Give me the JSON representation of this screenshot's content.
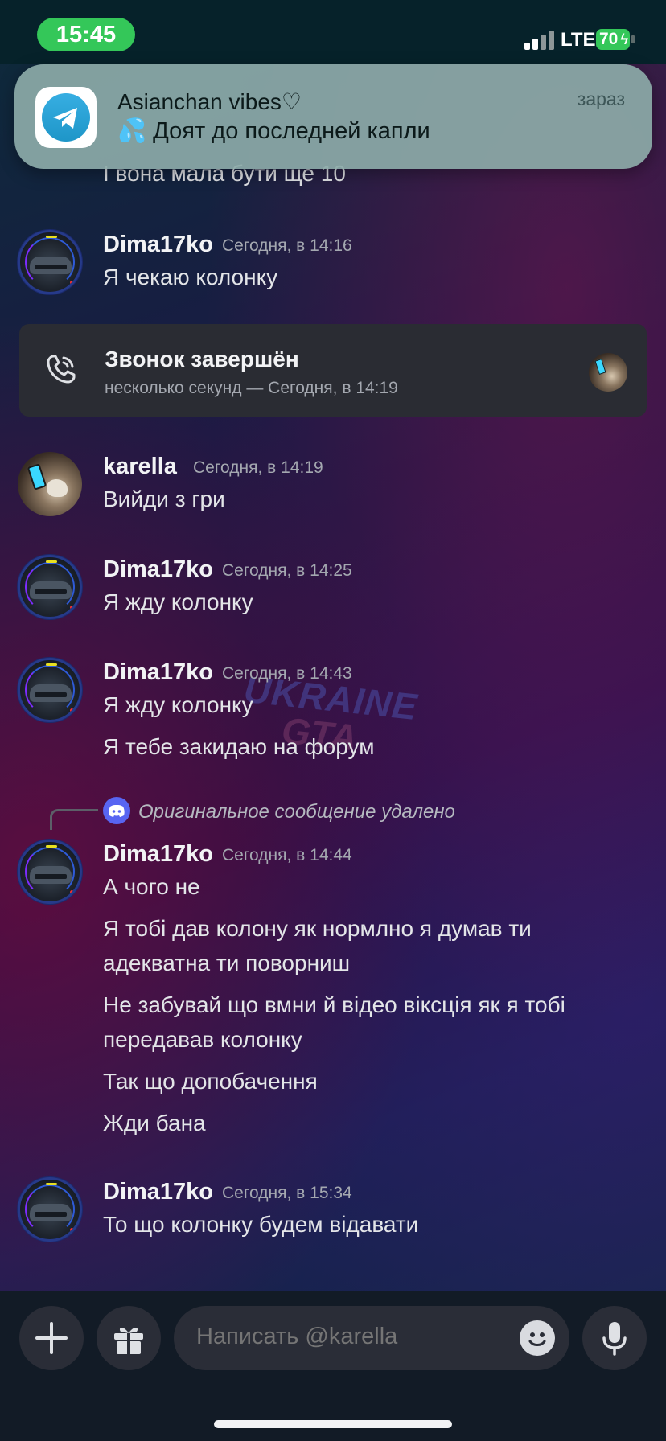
{
  "status_bar": {
    "time": "15:45",
    "network": "LTE",
    "battery": "70"
  },
  "notification": {
    "app_icon": "telegram-icon",
    "title": "Asianchan vibes♡",
    "body": "💦 Доят до последней капли",
    "time": "зараз"
  },
  "chat": {
    "cut_text": "І вона мала бути ще 10",
    "messages": [
      {
        "author": "Dima17ko",
        "timestamp": "Сегодня, в 14:16",
        "lines": [
          "Я чекаю колонку"
        ]
      },
      {
        "author": "karella",
        "timestamp": "Сегодня, в 14:19",
        "lines": [
          "Вийди з гри"
        ]
      },
      {
        "author": "Dima17ko",
        "timestamp": "Сегодня, в 14:25",
        "lines": [
          "Я жду колонку"
        ]
      },
      {
        "author": "Dima17ko",
        "timestamp": "Сегодня, в 14:43",
        "lines": [
          "Я жду колонку",
          "Я тебе закидаю на форум"
        ]
      },
      {
        "author": "Dima17ko",
        "timestamp": "Сегодня, в 14:44",
        "reply_reference": "Оригинальное сообщение удалено",
        "lines": [
          "А чого не",
          "Я тобі дав колону  як нормлно я думав ти",
          "адекватна ти поворниш",
          "Не забувай що вмни й відео віксція як я тобі",
          "передавав колонку",
          "Так що допобачення",
          "Жди бана"
        ]
      },
      {
        "author": "Dima17ko",
        "timestamp": "Сегодня, в 15:34",
        "lines": [
          "То що колонку будем відавати"
        ]
      }
    ],
    "call": {
      "title": "Звонок завершён",
      "subtitle": "несколько секунд — Сегодня, в 14:19"
    },
    "watermark": {
      "line1": "UKRAINE",
      "line2": "GTA"
    }
  },
  "composer": {
    "placeholder": "Написать @karella"
  },
  "colors": {
    "status_green": "#34c759",
    "discord_blurple": "#5865f2",
    "card_bg": "#2a2c33",
    "input_bg": "#2a2d37"
  }
}
